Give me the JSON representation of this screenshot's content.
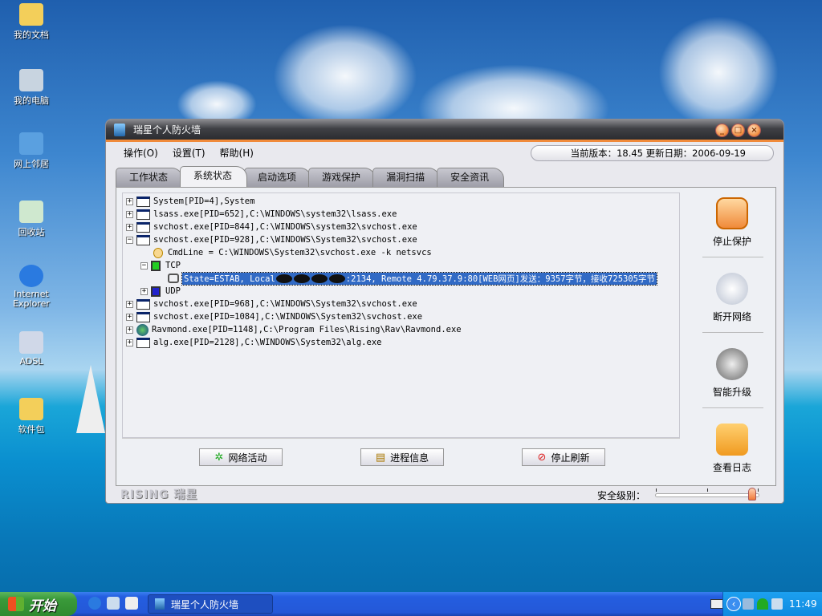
{
  "desktop": {
    "icons": [
      {
        "label": "我的文档",
        "icon": "folder-icon"
      },
      {
        "label": "我的电脑",
        "icon": "computer-icon"
      },
      {
        "label": "网上邻居",
        "icon": "network-icon"
      },
      {
        "label": "回收站",
        "icon": "recycle-bin-icon"
      },
      {
        "label": "Internet Explorer",
        "icon": "ie-icon"
      },
      {
        "label": "ADSL",
        "icon": "dialup-icon"
      },
      {
        "label": "软件包",
        "icon": "folder-icon"
      }
    ]
  },
  "window": {
    "title": "瑞星个人防火墙",
    "controls": [
      "_",
      "□",
      "×"
    ],
    "menu": [
      "操作(O)",
      "设置(T)",
      "帮助(H)"
    ],
    "version_text": "当前版本：18.45  更新日期：2006-09-19",
    "tabs": [
      {
        "label": "工作状态"
      },
      {
        "label": "系统状态",
        "active": true
      },
      {
        "label": "启动选项"
      },
      {
        "label": "游戏保护"
      },
      {
        "label": "漏洞扫描"
      },
      {
        "label": "安全资讯"
      }
    ],
    "tree": {
      "r0": "System[PID=4],System",
      "r1": "lsass.exe[PID=652],C:\\WINDOWS\\system32\\lsass.exe",
      "r2": "svchost.exe[PID=844],C:\\WINDOWS\\system32\\svchost.exe",
      "r3": "svchost.exe[PID=928],C:\\WINDOWS\\System32\\svchost.exe",
      "r4": "CmdLine = C:\\WINDOWS\\System32\\svchost.exe -k netsvcs",
      "r5": "TCP",
      "r6a": "State=ESTAB, Local",
      "r6b": ":2134, Remote 4.79.37.9:80[WEB网页]发送：9357字节，接收725305字节",
      "r7": "UDP",
      "r8": "svchost.exe[PID=968],C:\\WINDOWS\\System32\\svchost.exe",
      "r9": "svchost.exe[PID=1084],C:\\WINDOWS\\System32\\svchost.exe",
      "r10": "Ravmond.exe[PID=1148],C:\\Program Files\\Rising\\Rav\\Ravmond.exe",
      "r11": "alg.exe[PID=2128],C:\\WINDOWS\\System32\\alg.exe",
      "expanded": "−",
      "collapsed": "+"
    },
    "buttons": {
      "net": "网络活动",
      "proc": "进程信息",
      "stop": "停止刷新"
    },
    "side": {
      "stop_protect": "停止保护",
      "disconnect": "断开网络",
      "upgrade": "智能升级",
      "log": "查看日志"
    },
    "footer": {
      "logo": "RISING 瑞星",
      "security_label": "安全级别：",
      "security_level": 1.0
    }
  },
  "taskbar": {
    "start": "开始",
    "task": "瑞星个人防火墙",
    "clock": "11:49"
  },
  "colors": {
    "accent": "#f08a3a",
    "selection": "#316ac5"
  }
}
